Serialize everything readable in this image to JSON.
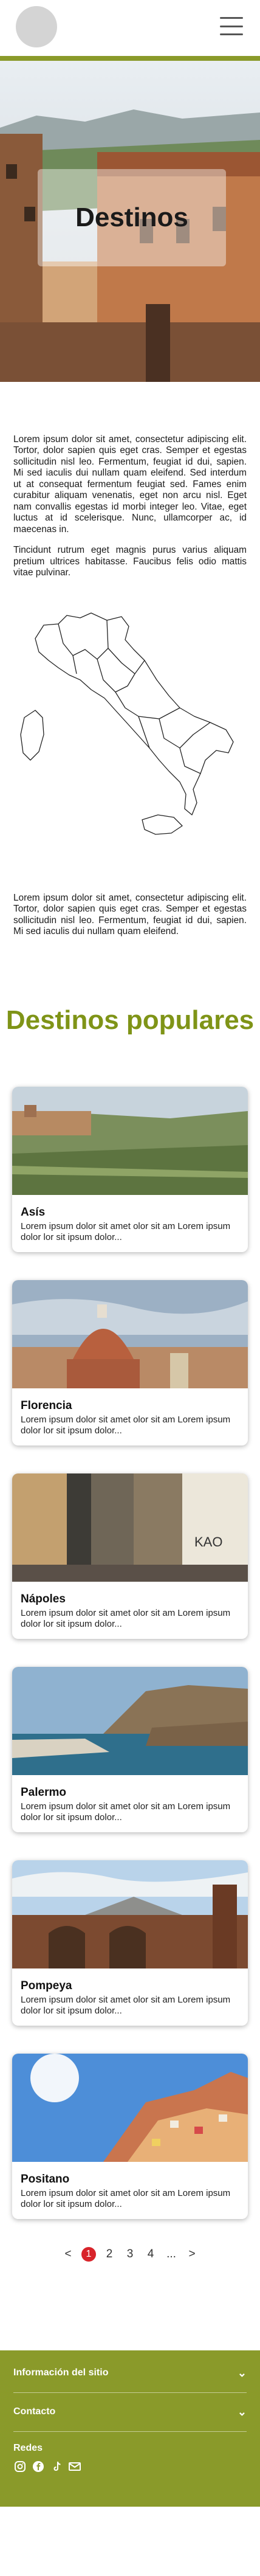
{
  "header": {
    "menu_icon": "hamburger-icon",
    "logo": "logo-placeholder"
  },
  "hero": {
    "title": "Destinos"
  },
  "intro": {
    "p1": "Lorem ipsum dolor sit amet, consectetur adipiscing elit. Tortor, dolor sapien quis eget cras. Semper et egestas sollicitudin nisl leo. Fermentum, feugiat id dui, sapien. Mi sed iaculis dui nullam quam eleifend. Sed interdum ut at consequat fermentum feugiat sed. Fames enim curabitur aliquam venenatis, eget non arcu nisl. Eget nam convallis egestas id morbi integer leo. Vitae, eget luctus at id scelerisque. Nunc, ullamcorper ac, id maecenas in.",
    "p2": "Tincidunt rutrum eget magnis purus varius aliquam pretium ultrices habitasse. Faucibus felis odio mattis vitae pulvinar.",
    "p3": "Lorem ipsum dolor sit amet, consectetur adipiscing elit. Tortor, dolor sapien quis eget cras. Semper et egestas sollicitudin nisl leo. Fermentum, feugiat id dui, sapien. Mi sed iaculis dui nullam quam eleifend."
  },
  "popular": {
    "title": "Destinos populares",
    "cards": [
      {
        "name": "Asís",
        "desc": "Lorem ipsum dolor sit amet olor sit am Lorem ipsum dolor lor sit ipsum dolor..."
      },
      {
        "name": "Florencia",
        "desc": "Lorem ipsum dolor sit amet olor sit am Lorem ipsum dolor lor sit ipsum dolor..."
      },
      {
        "name": "Nápoles",
        "desc": "Lorem ipsum dolor sit amet olor sit am Lorem ipsum dolor lor sit ipsum dolor..."
      },
      {
        "name": "Palermo",
        "desc": "Lorem ipsum dolor sit amet olor sit am Lorem ipsum dolor lor sit ipsum dolor..."
      },
      {
        "name": "Pompeya",
        "desc": "Lorem ipsum dolor sit amet olor sit am Lorem ipsum dolor lor sit ipsum dolor..."
      },
      {
        "name": "Positano",
        "desc": "Lorem ipsum dolor sit amet olor sit am Lorem ipsum dolor lor sit ipsum dolor..."
      }
    ]
  },
  "pagination": {
    "prev": "<",
    "pages": [
      "1",
      "2",
      "3",
      "4"
    ],
    "ellipsis": "...",
    "next": ">",
    "active": "1"
  },
  "footer": {
    "info_label": "Información del sitio",
    "contact_label": "Contacto",
    "social_label": "Redes",
    "social_icons": [
      "instagram-icon",
      "facebook-icon",
      "tiktok-icon",
      "mail-icon"
    ]
  },
  "colors": {
    "accent": "#8a9a2a",
    "title_green": "#7f9417",
    "active_page": "#d8242b"
  }
}
